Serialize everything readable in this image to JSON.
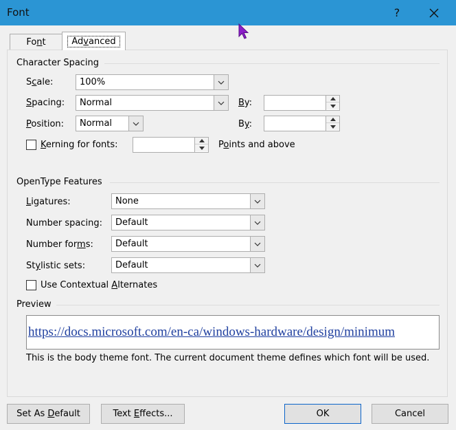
{
  "window": {
    "title": "Font",
    "help_label": "?",
    "close_label": "✕"
  },
  "tabs": [
    {
      "label": "Font",
      "mnemonic_pre": "Fo",
      "mnemonic_char": "n",
      "mnemonic_post": "t"
    },
    {
      "label": "Advanced",
      "mnemonic_pre": "Ad",
      "mnemonic_char": "v",
      "mnemonic_post": "anced"
    }
  ],
  "character_spacing": {
    "title": "Character Spacing",
    "scale": {
      "label_pre": "S",
      "label_char": "c",
      "label_post": "ale:",
      "value": "100%"
    },
    "spacing": {
      "label_pre": "",
      "label_char": "S",
      "label_post": "pacing:",
      "value": "Normal",
      "by_pre": "",
      "by_char": "B",
      "by_post": "y:",
      "by_value": ""
    },
    "position": {
      "label_pre": "",
      "label_char": "P",
      "label_post": "osition:",
      "value": "Normal",
      "by_pre": "B",
      "by_char": "y",
      "by_post": ":",
      "by_value": ""
    },
    "kerning": {
      "checked": false,
      "label_pre": "",
      "label_char": "K",
      "label_post": "erning for fonts:",
      "value": "",
      "suffix_pre": "",
      "suffix_char": "o",
      "suffix_post": "ints and above",
      "suffix_lead": "P"
    }
  },
  "opentype": {
    "title": "OpenType Features",
    "ligatures": {
      "label_pre": "",
      "label_char": "L",
      "label_post": "igatures:",
      "value": "None"
    },
    "number_spacing": {
      "label_pre": "Number spacing:",
      "value": "Default"
    },
    "number_forms": {
      "label_pre": "Number for",
      "label_char": "m",
      "label_post": "s:",
      "value": "Default"
    },
    "stylistic_sets": {
      "label_pre": "St",
      "label_char": "y",
      "label_post": "listic sets:",
      "value": "Default"
    },
    "contextual": {
      "checked": false,
      "label_pre": "Use Contextual ",
      "label_char": "A",
      "label_post": "lternates"
    }
  },
  "preview": {
    "title": "Preview",
    "sample": "https://docs.microsoft.com/en-ca/windows-hardware/design/minimum",
    "description": "This is the body theme font. The current document theme defines which font will be used."
  },
  "buttons": {
    "set_default": {
      "pre": "Set As ",
      "char": "D",
      "post": "efault"
    },
    "text_effects": {
      "pre": "Text ",
      "char": "E",
      "post": "ffects..."
    },
    "ok": "OK",
    "cancel": "Cancel"
  },
  "icons": {
    "dropdown": "chevron-down-icon",
    "spin_up": "triangle-up-icon",
    "spin_down": "triangle-down-icon",
    "cursor": "mouse-pointer-icon"
  },
  "colors": {
    "titlebar": "#2b95d4",
    "link": "#1f3f9f",
    "default_button_border": "#0a63c9",
    "cursor": "#8b1ec8"
  }
}
